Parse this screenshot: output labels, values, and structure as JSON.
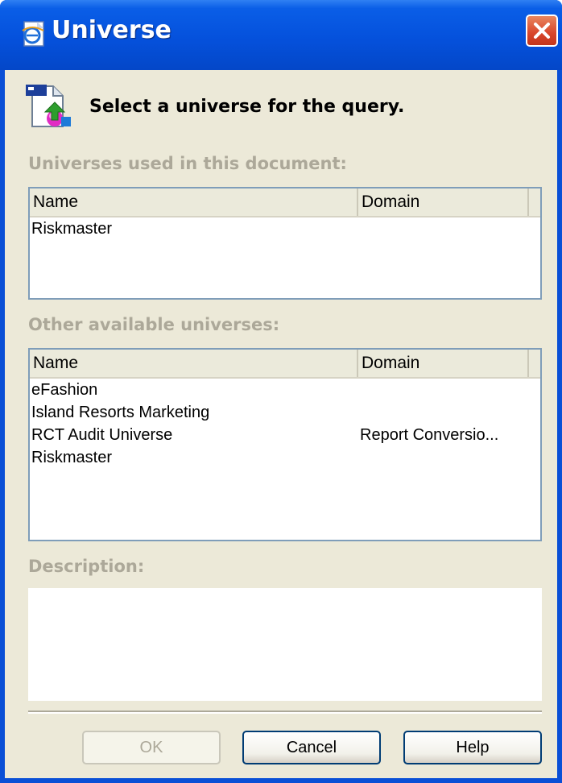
{
  "window": {
    "title": "Universe",
    "title_icon": "ie-page-icon",
    "close_icon": "close-icon",
    "colors": {
      "titlebar": "#0551dc",
      "client": "#ece9d8",
      "close": "#d8452a",
      "label_disabled": "#aca899"
    }
  },
  "header": {
    "icon": "universe-query-icon",
    "text": "Select a universe for the query."
  },
  "used": {
    "label": "Universes used in this document:",
    "columns": [
      "Name",
      "Domain"
    ],
    "rows": [
      {
        "name": "Riskmaster",
        "domain": ""
      }
    ]
  },
  "available": {
    "label": "Other available universes:",
    "columns": [
      "Name",
      "Domain"
    ],
    "rows": [
      {
        "name": "eFashion",
        "domain": ""
      },
      {
        "name": "Island Resorts Marketing",
        "domain": ""
      },
      {
        "name": "RCT Audit Universe",
        "domain": "Report Conversio..."
      },
      {
        "name": "Riskmaster",
        "domain": ""
      }
    ]
  },
  "description": {
    "label": "Description:",
    "text": ""
  },
  "buttons": {
    "ok": "OK",
    "cancel": "Cancel",
    "help": "Help"
  }
}
